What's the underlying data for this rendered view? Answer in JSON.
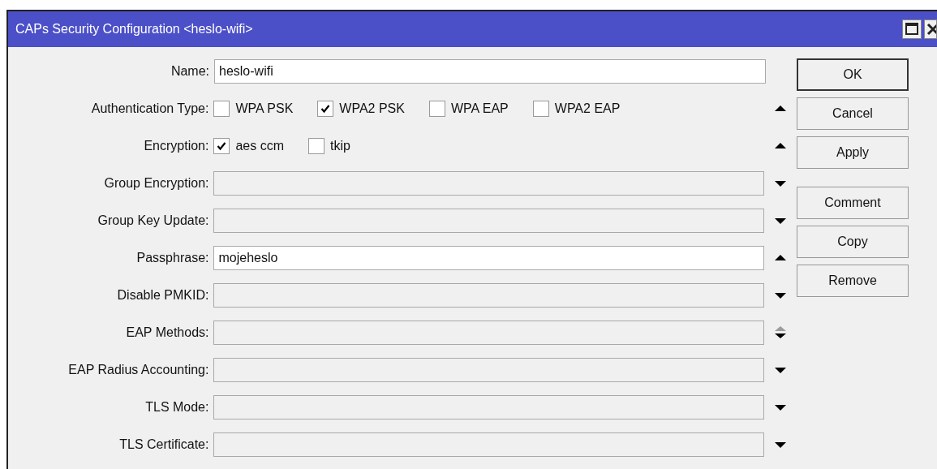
{
  "window": {
    "title": "CAPs Security Configuration <heslo-wifi>"
  },
  "rows": [
    {
      "label": "Name:",
      "kind": "text",
      "value": "heslo-wifi"
    },
    {
      "label": "Authentication Type:",
      "kind": "checks",
      "arrow": {
        "kind": "up"
      },
      "options": [
        {
          "label": "WPA PSK",
          "checked": false
        },
        {
          "label": "WPA2 PSK",
          "checked": true
        },
        {
          "label": "WPA EAP",
          "checked": false
        },
        {
          "label": "WPA2 EAP",
          "checked": false
        }
      ]
    },
    {
      "label": "Encryption:",
      "kind": "checks",
      "arrow": {
        "kind": "up"
      },
      "options": [
        {
          "label": "aes ccm",
          "checked": true
        },
        {
          "label": "tkip",
          "checked": false
        }
      ]
    },
    {
      "label": "Group Encryption:",
      "kind": "unset",
      "arrow": {
        "kind": "down"
      }
    },
    {
      "label": "Group Key Update:",
      "kind": "unset",
      "arrow": {
        "kind": "down"
      }
    },
    {
      "label": "Passphrase:",
      "kind": "text",
      "value": "mojeheslo",
      "arrow": {
        "kind": "up"
      }
    },
    {
      "label": "Disable PMKID:",
      "kind": "unset",
      "arrow": {
        "kind": "down"
      }
    },
    {
      "label": "EAP Methods:",
      "kind": "unset",
      "arrow": {
        "kind": "both"
      }
    },
    {
      "label": "EAP Radius Accounting:",
      "kind": "unset",
      "arrow": {
        "kind": "down"
      }
    },
    {
      "label": "TLS Mode:",
      "kind": "unset",
      "arrow": {
        "kind": "down"
      }
    },
    {
      "label": "TLS Certificate:",
      "kind": "unset",
      "arrow": {
        "kind": "down"
      }
    }
  ],
  "buttons": [
    {
      "label": "OK",
      "default": true
    },
    {
      "label": "Cancel",
      "default": false
    },
    {
      "label": "Apply",
      "default": false
    },
    {
      "label": "Comment",
      "default": false,
      "gap": true
    },
    {
      "label": "Copy",
      "default": false
    },
    {
      "label": "Remove",
      "default": false
    }
  ]
}
